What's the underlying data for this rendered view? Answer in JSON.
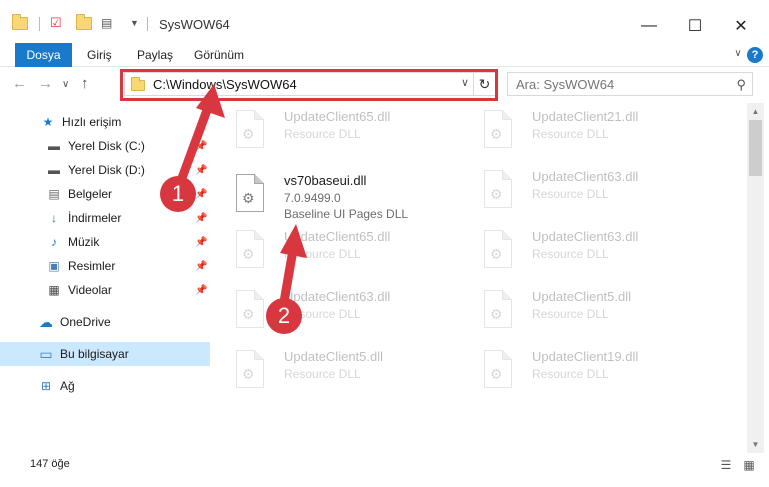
{
  "window": {
    "title": "SysWOW64",
    "minimize": "—",
    "maximize": "☐",
    "close": "✕"
  },
  "ribbon": {
    "tabs": [
      "Dosya",
      "Giriş",
      "Paylaş",
      "Görünüm"
    ],
    "expand": "∨",
    "help": "?"
  },
  "nav": {
    "back": "←",
    "forward": "→",
    "recent": "∨",
    "up": "↑",
    "address": "C:\\Windows\\SysWOW64",
    "address_dropdown": "∨",
    "refresh": "↻",
    "search_placeholder": "Ara: SysWOW64",
    "search_icon": "⚲"
  },
  "sidebar": {
    "items": [
      {
        "label": "Hızlı erişim",
        "icon": "star-icon",
        "glyph": "★",
        "pinned": false
      },
      {
        "label": "Yerel Disk (C:)",
        "icon": "drive-icon",
        "glyph": "▬",
        "pinned": true
      },
      {
        "label": "Yerel Disk (D:)",
        "icon": "drive-icon",
        "glyph": "▬",
        "pinned": true
      },
      {
        "label": "Belgeler",
        "icon": "documents-icon",
        "glyph": "▤",
        "pinned": true
      },
      {
        "label": "İndirmeler",
        "icon": "download-icon",
        "glyph": "↓",
        "pinned": true
      },
      {
        "label": "Müzik",
        "icon": "music-icon",
        "glyph": "♪",
        "pinned": true
      },
      {
        "label": "Resimler",
        "icon": "pictures-icon",
        "glyph": "▣",
        "pinned": true
      },
      {
        "label": "Videolar",
        "icon": "videos-icon",
        "glyph": "▦",
        "pinned": true
      },
      {
        "label": "OneDrive",
        "icon": "cloud-icon",
        "glyph": "☁",
        "pinned": false
      },
      {
        "label": "Bu bilgisayar",
        "icon": "computer-icon",
        "glyph": "▭",
        "pinned": false,
        "selected": true
      },
      {
        "label": "Ağ",
        "icon": "network-icon",
        "glyph": "⊞",
        "pinned": false
      }
    ],
    "pin_glyph": "📌"
  },
  "files": {
    "featured": {
      "name": "vs70baseui.dll",
      "version": "7.0.9499.0",
      "description": "Baseline UI Pages DLL"
    },
    "background": [
      {
        "name": "UpdateClient65.dll",
        "desc": "Resource DLL"
      },
      {
        "name": "UpdateClient21.dll",
        "desc": "Resource DLL"
      },
      {
        "name": "UpdateClient63.dll",
        "desc": "Resource DLL"
      },
      {
        "name": "UpdateClient65.dll",
        "desc": "Resource DLL"
      },
      {
        "name": "UpdateClient63.dll",
        "desc": "Resource DLL"
      },
      {
        "name": "UpdateClient63.dll",
        "desc": "Resource DLL"
      },
      {
        "name": "UpdateClient5.dll",
        "desc": "Resource DLL"
      },
      {
        "name": "UpdateClient5.dll",
        "desc": "Resource DLL"
      },
      {
        "name": "UpdateClient19.dll",
        "desc": "Resource DLL"
      }
    ],
    "gear_glyph": "⚙"
  },
  "status": {
    "count": "147 öğe",
    "details_view": "☰",
    "tiles_view": "▦"
  },
  "annotations": {
    "badge1": "1",
    "badge2": "2",
    "color": "#d9373f"
  }
}
